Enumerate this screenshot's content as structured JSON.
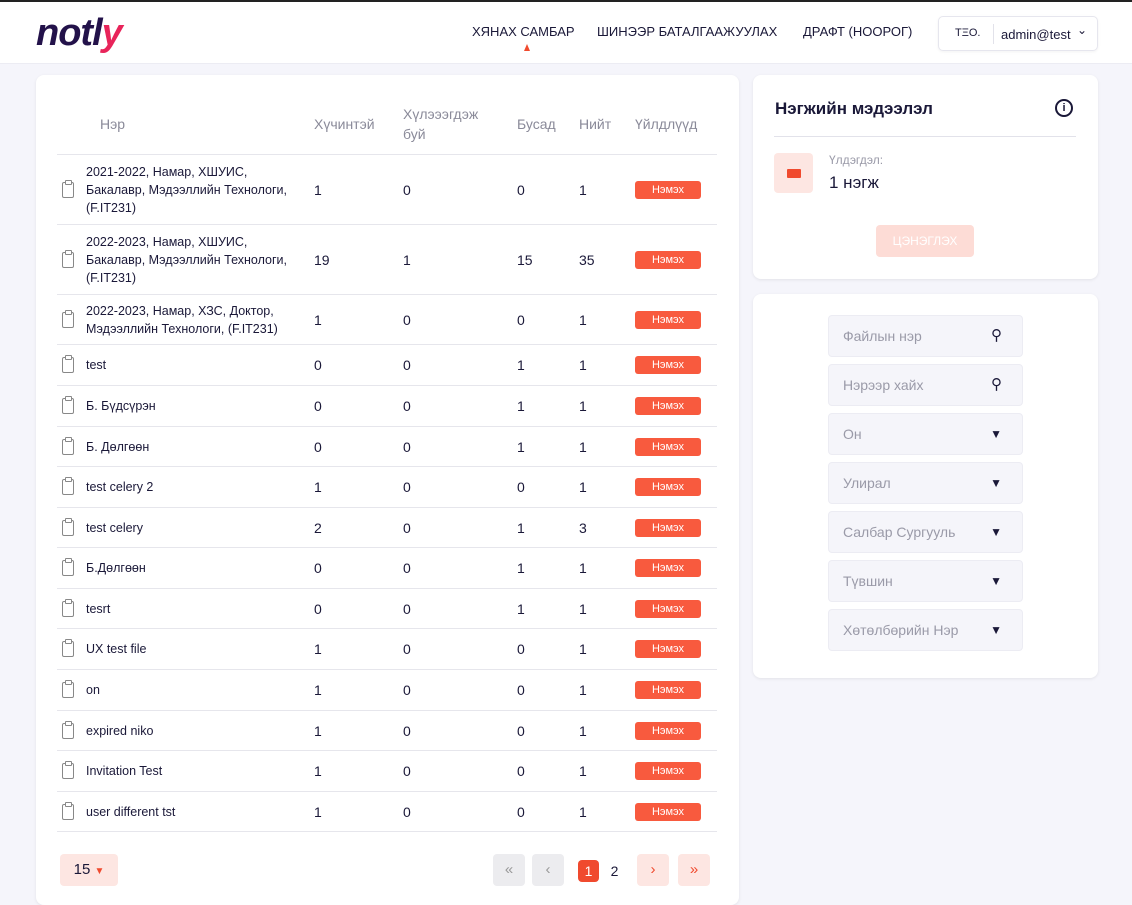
{
  "header": {
    "logo": "notly",
    "nav": [
      "ХЯНАХ САМБАР",
      "ШИНЭЭР БАТАЛГААЖУУЛАХ",
      "ДРАФТ (НООРОГ)"
    ],
    "org": "TΞO.",
    "user": "admin@test"
  },
  "table": {
    "columns": [
      "Нэр",
      "Хүчинтэй",
      "Хүлэээгдэж буй",
      "Бусад",
      "Нийт",
      "Үйлдлүүд"
    ],
    "action_label": "Нэмэх",
    "rows": [
      {
        "name": "2021-2022, Намар, ХШУИС, Бакалавр, Мэдээллийн Технологи, (F.IT231)",
        "valid": "1",
        "pending": "0",
        "other": "0",
        "total": "1"
      },
      {
        "name": "2022-2023, Намар, ХШУИС, Бакалавр, Мэдээллийн Технологи, (F.IT231)",
        "valid": "19",
        "pending": "1",
        "other": "15",
        "total": "35"
      },
      {
        "name": "2022-2023, Намар, ХЗС, Доктор, Мэдээллийн Технологи, (F.IT231)",
        "valid": "1",
        "pending": "0",
        "other": "0",
        "total": "1"
      },
      {
        "name": "test",
        "valid": "0",
        "pending": "0",
        "other": "1",
        "total": "1"
      },
      {
        "name": "Б. Бүдсүрэн",
        "valid": "0",
        "pending": "0",
        "other": "1",
        "total": "1"
      },
      {
        "name": "Б. Дөлгөөн",
        "valid": "0",
        "pending": "0",
        "other": "1",
        "total": "1"
      },
      {
        "name": "test celery 2",
        "valid": "1",
        "pending": "0",
        "other": "0",
        "total": "1"
      },
      {
        "name": "test celery",
        "valid": "2",
        "pending": "0",
        "other": "1",
        "total": "3"
      },
      {
        "name": "Б.Дөлгөөн",
        "valid": "0",
        "pending": "0",
        "other": "1",
        "total": "1"
      },
      {
        "name": "tesrt",
        "valid": "0",
        "pending": "0",
        "other": "1",
        "total": "1"
      },
      {
        "name": "UX test file",
        "valid": "1",
        "pending": "0",
        "other": "0",
        "total": "1"
      },
      {
        "name": "on",
        "valid": "1",
        "pending": "0",
        "other": "0",
        "total": "1"
      },
      {
        "name": "expired niko",
        "valid": "1",
        "pending": "0",
        "other": "0",
        "total": "1"
      },
      {
        "name": "Invitation Test",
        "valid": "1",
        "pending": "0",
        "other": "0",
        "total": "1"
      },
      {
        "name": "user different tst",
        "valid": "1",
        "pending": "0",
        "other": "0",
        "total": "1"
      }
    ]
  },
  "pagination": {
    "page_size": "15",
    "pages": [
      "1",
      "2"
    ],
    "current": "1"
  },
  "info": {
    "title": "Нэгжийн мэдээлэл",
    "balance_label": "Үлдэгдэл:",
    "balance_value": "1 нэгж",
    "recharge": "ЦЭНЭГЛЭХ"
  },
  "filters": [
    {
      "placeholder": "Файлын нэр",
      "icon": "search"
    },
    {
      "placeholder": "Нэрээр хайх",
      "icon": "search"
    },
    {
      "placeholder": "Он",
      "icon": "dropdown"
    },
    {
      "placeholder": "Улирал",
      "icon": "dropdown"
    },
    {
      "placeholder": "Салбар Сургууль",
      "icon": "dropdown"
    },
    {
      "placeholder": "Түвшин",
      "icon": "dropdown"
    },
    {
      "placeholder": "Хөтөлбөрийн Нэр",
      "icon": "dropdown"
    }
  ],
  "colors": {
    "accent": "#f85a3e",
    "navy": "#1a1838"
  }
}
